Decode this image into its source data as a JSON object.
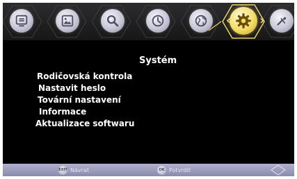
{
  "menu": {
    "title": "Systém",
    "items": [
      {
        "label": "Rodičovská kontrola"
      },
      {
        "label": "Nastavit heslo"
      },
      {
        "label": "Tovární nastavení"
      },
      {
        "label": "Informace"
      },
      {
        "label": "Aktualizace softwaru"
      }
    ]
  },
  "topbar": {
    "tabs": [
      {
        "name": "channel-list",
        "icon": "tv-guide-icon",
        "active": false
      },
      {
        "name": "picture",
        "icon": "picture-icon",
        "active": false
      },
      {
        "name": "search",
        "icon": "search-icon",
        "active": false
      },
      {
        "name": "time",
        "icon": "clock-icon",
        "active": false
      },
      {
        "name": "language",
        "icon": "globe-icon",
        "active": false
      },
      {
        "name": "system",
        "icon": "gear-icon",
        "active": true
      },
      {
        "name": "tools",
        "icon": "tools-icon",
        "active": false
      }
    ]
  },
  "footer": {
    "back_label": "Návrat",
    "confirm_label": "Potvrdit",
    "back_key": "EXIT",
    "confirm_key": "OK"
  },
  "colors": {
    "accent": "#e9d36a",
    "bar": "#9a9abc",
    "background": "#000000"
  }
}
